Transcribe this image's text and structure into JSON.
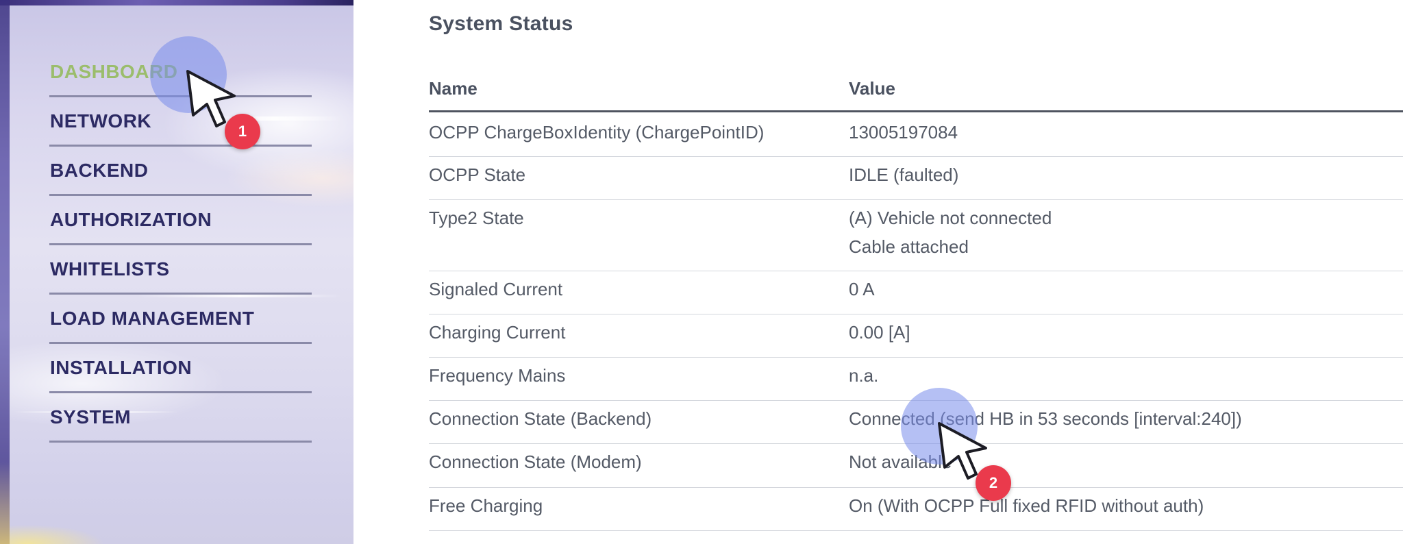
{
  "sidebar": {
    "items": [
      {
        "label": "DASHBOARD",
        "active": true
      },
      {
        "label": "NETWORK"
      },
      {
        "label": "BACKEND"
      },
      {
        "label": "AUTHORIZATION"
      },
      {
        "label": "WHITELISTS"
      },
      {
        "label": "LOAD MANAGEMENT"
      },
      {
        "label": "INSTALLATION"
      },
      {
        "label": "SYSTEM"
      }
    ]
  },
  "main": {
    "title": "System Status",
    "columns": [
      "Name",
      "Value"
    ],
    "rows": [
      {
        "name": "OCPP ChargeBoxIdentity (ChargePointID)",
        "value": "13005197084"
      },
      {
        "name": "OCPP State",
        "value": "IDLE (faulted)"
      },
      {
        "name": "Type2 State",
        "value": "(A) Vehicle not connected",
        "value2": "Cable attached"
      },
      {
        "name": "Signaled Current",
        "value": "0 A"
      },
      {
        "name": "Charging Current",
        "value": "0.00 [A]"
      },
      {
        "name": "Frequency Mains",
        "value": "n.a."
      },
      {
        "name": "Connection State (Backend)",
        "value": "Connected (send HB in 53 seconds [interval:240])"
      },
      {
        "name": "Connection State (Modem)",
        "value": "Not available"
      },
      {
        "name": "Free Charging",
        "value": "On (With OCPP Full fixed RFID without auth)"
      },
      {
        "name": "",
        "value": ""
      }
    ]
  },
  "annotations": {
    "step1": "1",
    "step2": "2",
    "badge_color": "#ea3a4c",
    "highlight_color": "#788ceb"
  },
  "colors": {
    "active_nav": "#9bbd6c",
    "nav_text": "#2c2a63",
    "body_text": "#545a66"
  }
}
